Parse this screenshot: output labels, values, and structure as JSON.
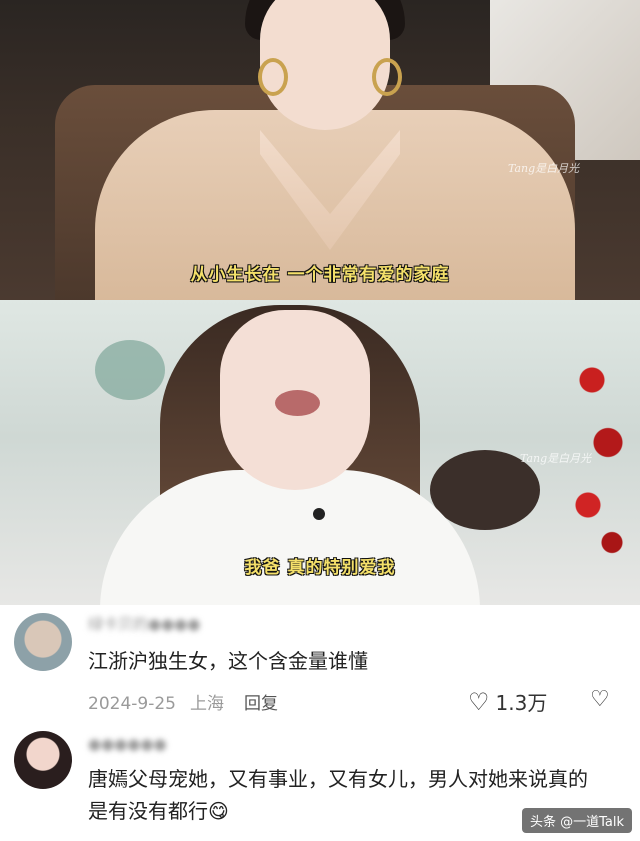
{
  "video_frames": [
    {
      "subtitle": "从小生长在 一个非常有爱的家庭",
      "watermark": "Tang是白月光"
    },
    {
      "subtitle": "我爸 真的特别爱我",
      "watermark": "Tang是白月光"
    }
  ],
  "comments": [
    {
      "username": "绿卡贝的●●●●",
      "text": "江浙沪独生女，这个含金量谁懂",
      "date": "2024-9-25",
      "location": "上海",
      "reply_label": "回复",
      "likes": "1.3万"
    },
    {
      "username": "●●●●●●",
      "text": "唐嫣父母宠她，又有事业，又有女儿，男人对她来说真的是有没有都行😋"
    }
  ],
  "footer_tag": "头条 @一道Talk",
  "icons": {
    "like": "heart-icon",
    "dislike": "broken-heart-icon"
  }
}
